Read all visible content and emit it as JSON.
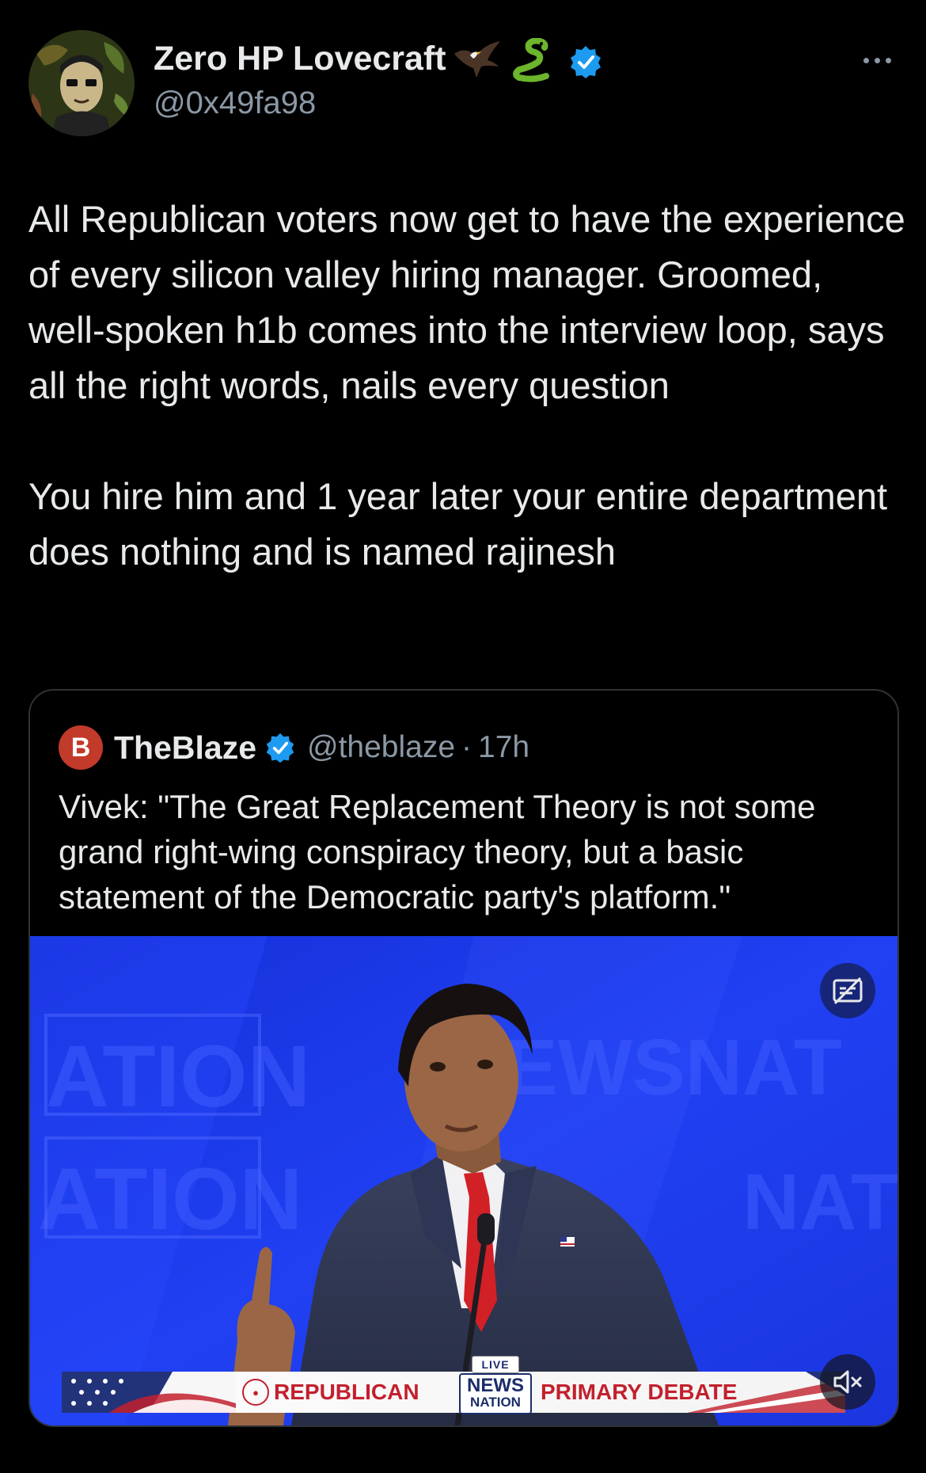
{
  "author": {
    "name": "Zero HP Lovecraft",
    "handle": "@0x49fa98",
    "emoji_icons": [
      "eagle-emoji-icon",
      "snake-emoji-icon"
    ],
    "verified_icon": "verified-badge-icon"
  },
  "tweet": {
    "paragraph_1": "All Republican voters now get to have the experience of every silicon valley hiring manager. Groomed, well-spoken h1b comes into the interview loop, says all the right words, nails every question",
    "paragraph_2": "You hire him and 1 year later your entire department does nothing and is named rajinesh"
  },
  "quoted": {
    "logo_letter": "B",
    "name": "TheBlaze",
    "handle": "@theblaze",
    "separator": "·",
    "time": "17h",
    "text": "Vivek: \"The Great Replacement Theory is not some grand right-wing conspiracy theory, but a basic statement of the Democratic party's platform.\"",
    "media": {
      "banner_left": "REPUBLICAN",
      "banner_live": "LIVE",
      "banner_news_top": "NEWS",
      "banner_news_bottom": "NATION",
      "banner_right": "PRIMARY DEBATE",
      "background_text": [
        "ATION",
        "EWSNAT",
        "ATION",
        "NAT"
      ],
      "colors": {
        "backdrop": "#1f3cf0",
        "banner_red": "#c2202d",
        "banner_navy": "#1b2c6a"
      }
    }
  },
  "colors": {
    "background": "#000000",
    "text": "#e7e9ea",
    "secondary": "#8b98a5",
    "verified": "#1d9bf0",
    "border": "#2f3336"
  }
}
